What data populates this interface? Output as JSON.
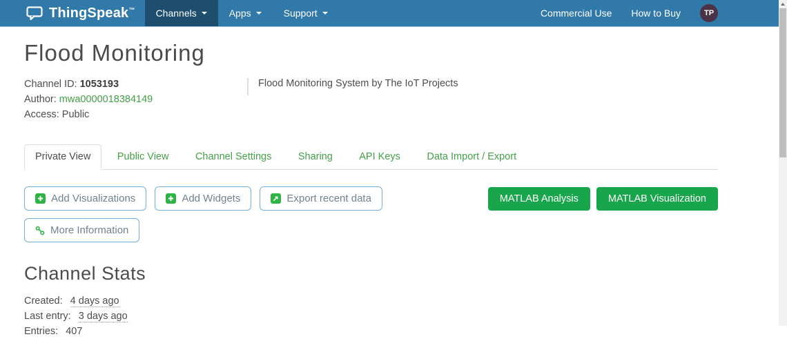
{
  "icons": {
    "brand": "speech-bubble-icon",
    "nav_dropdown": "caret-down-icon",
    "add": "plus-square-icon",
    "export": "export-square-icon",
    "more_info": "link-icon",
    "scrollbar_up": "triangle-up-icon"
  },
  "colors": {
    "navbar_bg": "#3179a8",
    "navbar_active_bg": "#1d4e6d",
    "green_button": "#18a54b",
    "green_icon": "#2fb344",
    "green_link": "#43a047",
    "outline_button_border": "#6fb0de",
    "outline_button_text": "#73828e",
    "avatar_bg": "#4a3347",
    "body_text": "#4d4d4d"
  },
  "navbar": {
    "brand": "ThingSpeak",
    "brand_tm": "™",
    "items": [
      {
        "label": "Channels",
        "active": true
      },
      {
        "label": "Apps",
        "active": false
      },
      {
        "label": "Support",
        "active": false
      }
    ],
    "right_links": [
      {
        "label": "Commercial Use"
      },
      {
        "label": "How to Buy"
      }
    ],
    "avatar_initials": "TP"
  },
  "header": {
    "title": "Flood Monitoring",
    "channel_id_label": "Channel ID:",
    "channel_id_value": "1053193",
    "author_label": "Author:",
    "author_value": "mwa0000018384149",
    "access_label": "Access:",
    "access_value": "Public",
    "description": "Flood Monitoring System by The IoT Projects"
  },
  "tabs": [
    {
      "label": "Private View",
      "active": true
    },
    {
      "label": "Public View",
      "active": false
    },
    {
      "label": "Channel Settings",
      "active": false
    },
    {
      "label": "Sharing",
      "active": false
    },
    {
      "label": "API Keys",
      "active": false
    },
    {
      "label": "Data Import / Export",
      "active": false
    }
  ],
  "toolbar": {
    "add_visualizations_label": "Add Visualizations",
    "add_widgets_label": "Add Widgets",
    "export_recent_data_label": "Export recent data",
    "matlab_analysis_label": "MATLAB Analysis",
    "matlab_visualization_label": "MATLAB Visualization",
    "more_information_label": "More Information"
  },
  "channel_stats": {
    "heading": "Channel Stats",
    "rows": [
      {
        "label": "Created:",
        "value": "4 days ago"
      },
      {
        "label": "Last entry:",
        "value": "3 days ago"
      },
      {
        "label": "Entries:",
        "value": "407"
      }
    ]
  }
}
